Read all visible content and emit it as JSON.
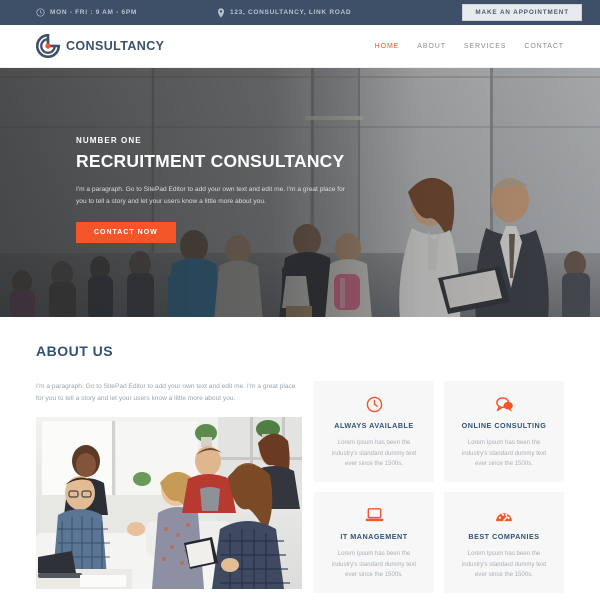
{
  "topbar": {
    "hours_icon": "clock-icon",
    "hours": "MON - FRI : 9 AM - 6PM",
    "location_icon": "map-pin-icon",
    "address": "123, CONSULTANCY, LINK ROAD",
    "appointment_label": "MAKE AN APPOINTMENT",
    "background_color": "#3d5068",
    "text_color": "#b9c3cf"
  },
  "header": {
    "logo_icon": "circular-target-logo",
    "logo_text": "CONSULTANCY",
    "nav": [
      {
        "label": "HOME",
        "active": true
      },
      {
        "label": "ABOUT",
        "active": false
      },
      {
        "label": "SERVICES",
        "active": false
      },
      {
        "label": "CONTACT",
        "active": false
      }
    ],
    "brand_color": "#3d5068",
    "accent_color": "#f4562a"
  },
  "hero": {
    "eyebrow": "NUMBER ONE",
    "title": "RECRUITMENT CONSULTANCY",
    "paragraph": "I'm a paragraph. Go to SitePad Editor to add your own text and edit me. I'm a great place for you to tell a story and let your users know a little more about you.",
    "cta_label": "CONTACT NOW",
    "cta_color": "#f4562a",
    "image_alt": "Crowd of people walking in a modern glass atrium with a businesswoman and businessman reviewing a clipboard"
  },
  "about": {
    "title": "ABOUT US",
    "paragraph": "I'm a paragraph. Go to SitePad Editor to add your own text and edit me. I'm a great place for you to tell a story and let your users know a little more about you.",
    "image_alt": "Team of young professionals in a casual office meeting",
    "title_color": "#2f5276"
  },
  "features": [
    {
      "icon": "clock-icon",
      "title": "ALWAYS AVAILABLE",
      "text": "Lorem Ipsum has been the industry's standard dummy text ever since the 1500s."
    },
    {
      "icon": "chat-bubbles-icon",
      "title": "ONLINE CONSULTING",
      "text": "Lorem Ipsum has been the industry's standard dummy text ever since the 1500s."
    },
    {
      "icon": "laptop-icon",
      "title": "IT MANAGEMENT",
      "text": "Lorem Ipsum has been the industry's standard dummy text ever since the 1500s."
    },
    {
      "icon": "gauge-icon",
      "title": "BEST COMPANIES",
      "text": "Lorem Ipsum has been the industry's standard dummy text ever since the 1500s."
    }
  ]
}
